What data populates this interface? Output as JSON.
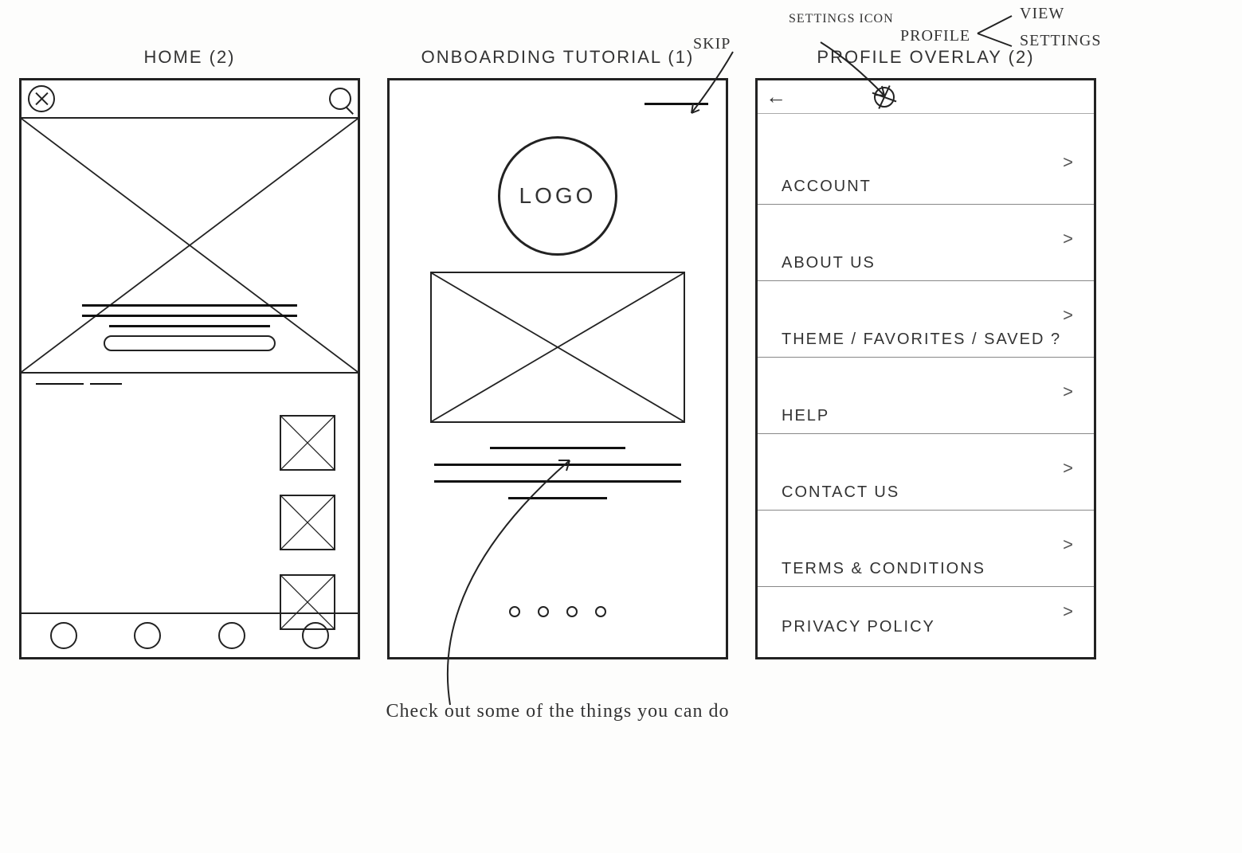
{
  "frames": {
    "home": {
      "title": "HOME (2)"
    },
    "onboarding": {
      "title": "ONBOARDING TUTORIAL (1)",
      "logo_text": "LOGO",
      "pager_count": 4
    },
    "profile": {
      "title": "PROFILE OVERLAY (2)",
      "items": [
        "ACCOUNT",
        "ABOUT US",
        "THEME / FAVORITES / SAVED ?",
        "HELP",
        "CONTACT US",
        "TERMS & CONDITIONS",
        "PRIVACY POLICY"
      ]
    }
  },
  "annotations": {
    "skip": "SKIP",
    "settings_icon": "SETTINGS ICON",
    "profile": "PROFILE",
    "view": "VIEW",
    "settings": "SETTINGS",
    "caption": "Check out some of the things you can do"
  }
}
